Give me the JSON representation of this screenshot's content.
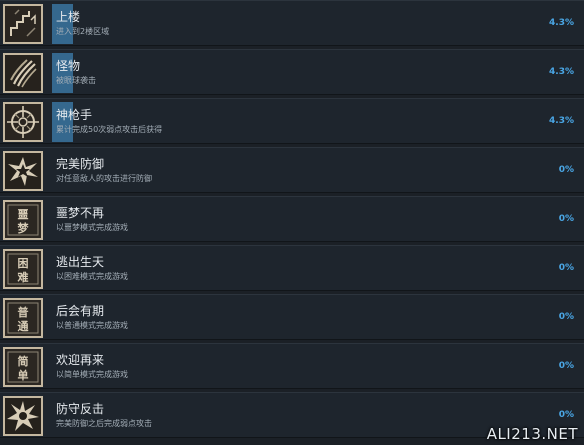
{
  "achievements": [
    {
      "title": "上楼",
      "desc": "进入到2楼区域",
      "pct_label": "4.3%",
      "progress": 0.043,
      "icon": "stairs-icon"
    },
    {
      "title": "怪物",
      "desc": "被眼球袭击",
      "pct_label": "4.3%",
      "progress": 0.043,
      "icon": "claw-marks-icon"
    },
    {
      "title": "神枪手",
      "desc": "累计完成50次弱点攻击后获得",
      "pct_label": "4.3%",
      "progress": 0.043,
      "icon": "crosshair-icon"
    },
    {
      "title": "完美防御",
      "desc": "对任意敌人的攻击进行防御",
      "pct_label": "0%",
      "progress": 0,
      "icon": "burst-icon"
    },
    {
      "title": "噩梦不再",
      "desc": "以噩梦模式完成游戏",
      "pct_label": "0%",
      "progress": 0,
      "icon": "nightmare-badge-icon",
      "badge": [
        "噩",
        "梦"
      ]
    },
    {
      "title": "逃出生天",
      "desc": "以困难模式完成游戏",
      "pct_label": "0%",
      "progress": 0,
      "icon": "hard-badge-icon",
      "badge": [
        "困",
        "难"
      ]
    },
    {
      "title": "后会有期",
      "desc": "以普通模式完成游戏",
      "pct_label": "0%",
      "progress": 0,
      "icon": "normal-badge-icon",
      "badge": [
        "普",
        "通"
      ]
    },
    {
      "title": "欢迎再来",
      "desc": "以简单模式完成游戏",
      "pct_label": "0%",
      "progress": 0,
      "icon": "easy-badge-icon",
      "badge": [
        "简",
        "单"
      ]
    },
    {
      "title": "防守反击",
      "desc": "完美防御之后完成弱点攻击",
      "pct_label": "0%",
      "progress": 0,
      "icon": "counter-burst-icon"
    }
  ],
  "watermark": "ALI213.NET",
  "colors": {
    "row_bg": "#1e252d",
    "progress_bar": "#35688e",
    "percent_text": "#4aa7e6",
    "icon_border": "#c4b79f"
  }
}
